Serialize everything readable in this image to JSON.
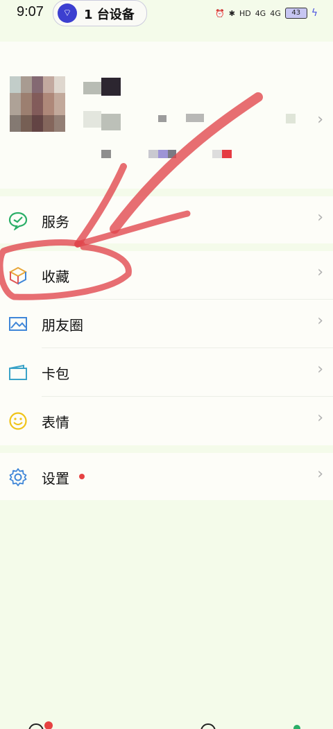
{
  "status_bar": {
    "time": "9:07",
    "device_pill": "1 台设备",
    "battery": "43",
    "network_labels": [
      "HD",
      "4G",
      "4G"
    ]
  },
  "menu": {
    "services": {
      "label": "服务"
    },
    "favorites": {
      "label": "收藏"
    },
    "moments": {
      "label": "朋友圈"
    },
    "cards": {
      "label": "卡包"
    },
    "stickers": {
      "label": "表情"
    },
    "settings": {
      "label": "设置"
    }
  },
  "colors": {
    "background": "#f4fbea",
    "services_icon": "#2aae67",
    "annotation": "#e0454c",
    "badge": "#e64242"
  }
}
